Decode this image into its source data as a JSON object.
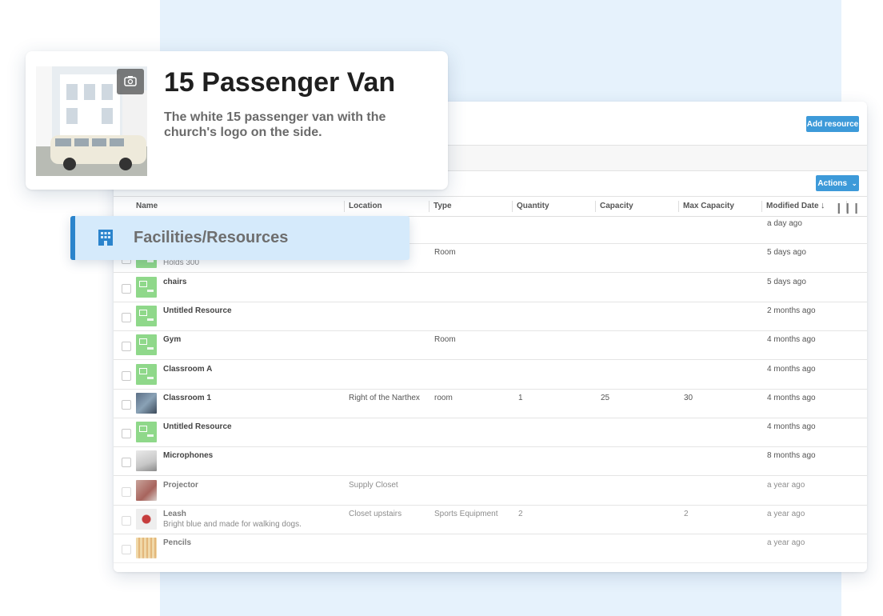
{
  "toolbar": {
    "add_resource": "Add resource",
    "actions": "Actions"
  },
  "columns": {
    "name": "Name",
    "location": "Location",
    "type": "Type",
    "quantity": "Quantity",
    "capacity": "Capacity",
    "max_capacity": "Max Capacity",
    "modified_date": "Modified Date",
    "sort_icon": "arrow-down-icon"
  },
  "rows": [
    {
      "name": "",
      "sub": "",
      "location": "",
      "type": "",
      "quantity": "",
      "capacity": "",
      "max_capacity": "",
      "modified": "a day ago",
      "thumb": "none"
    },
    {
      "name": "",
      "sub": "Holds 300",
      "location": "",
      "type": "Room",
      "quantity": "",
      "capacity": "",
      "max_capacity": "",
      "modified": "5 days ago",
      "thumb": "green"
    },
    {
      "name": "chairs",
      "sub": "",
      "location": "",
      "type": "",
      "quantity": "",
      "capacity": "",
      "max_capacity": "",
      "modified": "5 days ago",
      "thumb": "green"
    },
    {
      "name": "Untitled Resource",
      "sub": "",
      "location": "",
      "type": "",
      "quantity": "",
      "capacity": "",
      "max_capacity": "",
      "modified": "2 months ago",
      "thumb": "green"
    },
    {
      "name": "Gym",
      "sub": "",
      "location": "",
      "type": "Room",
      "quantity": "",
      "capacity": "",
      "max_capacity": "",
      "modified": "4 months ago",
      "thumb": "green"
    },
    {
      "name": "Classroom A",
      "sub": "",
      "location": "",
      "type": "",
      "quantity": "",
      "capacity": "",
      "max_capacity": "",
      "modified": "4 months ago",
      "thumb": "green"
    },
    {
      "name": "Classroom 1",
      "sub": "",
      "location": "Right of the Narthex",
      "type": "room",
      "quantity": "1",
      "capacity": "25",
      "max_capacity": "30",
      "modified": "4 months ago",
      "thumb": "photo1"
    },
    {
      "name": "Untitled Resource",
      "sub": "",
      "location": "",
      "type": "",
      "quantity": "",
      "capacity": "",
      "max_capacity": "",
      "modified": "4 months ago",
      "thumb": "green"
    },
    {
      "name": "Microphones",
      "sub": "",
      "location": "",
      "type": "",
      "quantity": "",
      "capacity": "",
      "max_capacity": "",
      "modified": "8 months ago",
      "thumb": "photo2"
    },
    {
      "name": "Projector",
      "sub": "",
      "location": "Supply Closet",
      "type": "",
      "quantity": "",
      "capacity": "",
      "max_capacity": "",
      "modified": "a year ago",
      "thumb": "photo3"
    },
    {
      "name": "Leash",
      "sub": "Bright blue and made for walking dogs.",
      "location": "Closet upstairs",
      "type": "Sports Equipment",
      "quantity": "2",
      "capacity": "",
      "max_capacity": "2",
      "modified": "a year ago",
      "thumb": "photo4"
    },
    {
      "name": "Pencils",
      "sub": "",
      "location": "",
      "type": "",
      "quantity": "",
      "capacity": "",
      "max_capacity": "",
      "modified": "a year ago",
      "thumb": "photo5"
    }
  ],
  "facilities": {
    "label": "Facilities/Resources",
    "icon": "building-icon",
    "accent": "#2b84cc"
  },
  "van": {
    "title": "15 Passenger Van",
    "description": "The white 15 passenger van with the church's logo on the side.",
    "camera_icon": "camera-icon"
  },
  "colors": {
    "primary_button": "#3d9ad9",
    "background_panel": "#e6f2fc",
    "facility_bg": "#d5eafb"
  }
}
